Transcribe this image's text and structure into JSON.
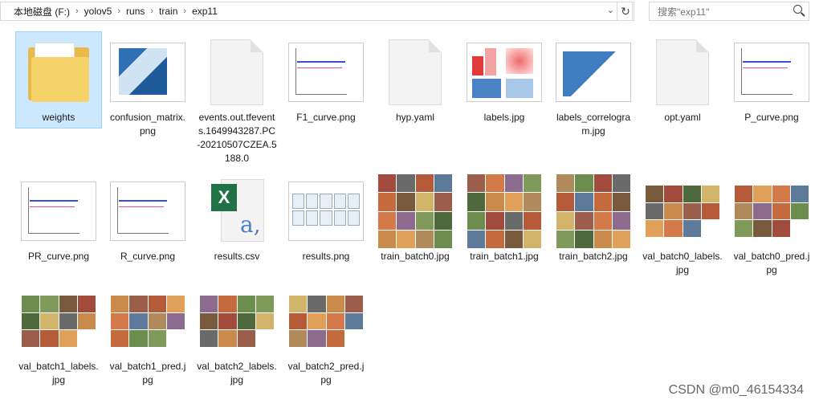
{
  "address": {
    "crumbs": [
      "本地磁盘 (F:)",
      "yolov5",
      "runs",
      "train",
      "exp11"
    ],
    "refresh_icon": "refresh-icon",
    "dropdown_icon": "chevron-down-icon"
  },
  "search": {
    "placeholder": "搜索\"exp11\""
  },
  "files": [
    {
      "name": "weights",
      "kind": "folder",
      "selected": true
    },
    {
      "name": "confusion_matrix.png",
      "kind": "png-matrix"
    },
    {
      "name": "events.out.tfevents.1649943287.PC-20210507CZEA.5188.0",
      "kind": "doc"
    },
    {
      "name": "F1_curve.png",
      "kind": "png-curve"
    },
    {
      "name": "hyp.yaml",
      "kind": "doc"
    },
    {
      "name": "labels.jpg",
      "kind": "png-labels"
    },
    {
      "name": "labels_correlogram.jpg",
      "kind": "png-corr"
    },
    {
      "name": "opt.yaml",
      "kind": "doc"
    },
    {
      "name": "P_curve.png",
      "kind": "png-curve"
    },
    {
      "name": "PR_curve.png",
      "kind": "png-curve"
    },
    {
      "name": "R_curve.png",
      "kind": "png-curve"
    },
    {
      "name": "results.csv",
      "kind": "csv"
    },
    {
      "name": "results.png",
      "kind": "png-results"
    },
    {
      "name": "train_batch0.jpg",
      "kind": "mosaic"
    },
    {
      "name": "train_batch1.jpg",
      "kind": "mosaic"
    },
    {
      "name": "train_batch2.jpg",
      "kind": "mosaic"
    },
    {
      "name": "val_batch0_labels.jpg",
      "kind": "val"
    },
    {
      "name": "val_batch0_pred.jpg",
      "kind": "val"
    },
    {
      "name": "val_batch1_labels.jpg",
      "kind": "val"
    },
    {
      "name": "val_batch1_pred.jpg",
      "kind": "val"
    },
    {
      "name": "val_batch2_labels.jpg",
      "kind": "val"
    },
    {
      "name": "val_batch2_pred.jpg",
      "kind": "val"
    }
  ],
  "watermark": "CSDN @m0_46154334",
  "colors": {
    "selection": "#cce8ff",
    "folder": "#f6d26a",
    "excel": "#1f7244"
  }
}
